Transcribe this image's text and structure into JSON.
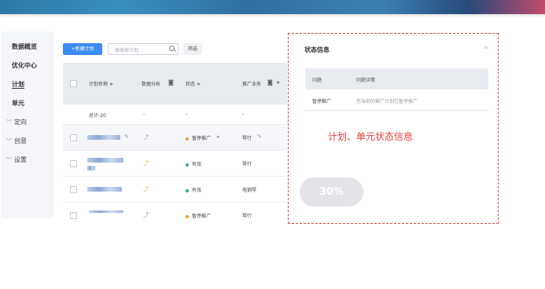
{
  "sidebar": {
    "items": [
      {
        "label": "数据概览"
      },
      {
        "label": "优化中心"
      },
      {
        "label": "计划"
      },
      {
        "label": "单元"
      },
      {
        "label": "定向"
      },
      {
        "label": "创意"
      },
      {
        "label": "设置"
      }
    ]
  },
  "toolbar": {
    "new_plan_label": "+新建计划",
    "search_placeholder": "搜搜索计划",
    "filter_label": "筛选"
  },
  "table": {
    "columns": [
      "计划名称 ≑",
      "数据分析",
      "状态 ≑",
      "推广业务",
      "≑"
    ],
    "total_row": {
      "name": "总计-20",
      "analysis": "-",
      "status": "-",
      "business": "-"
    },
    "rows": [
      {
        "status": "暂停推广",
        "status_color": "#f39b22",
        "business": "琴行"
      },
      {
        "status": "有效",
        "status_color": "#2db36b",
        "business": "琴行"
      },
      {
        "status": "有效",
        "status_color": "#2db36b",
        "business": "电钢琴"
      },
      {
        "status": "暂停推广",
        "status_color": "#f39b22",
        "business": "琴行"
      }
    ]
  },
  "state_panel": {
    "title": "状态信息",
    "close_icon": "×",
    "columns": [
      "问题",
      "问题详情"
    ],
    "rows": [
      {
        "issue": "暂停推广",
        "detail": "您当前的推广计划已暂停推广"
      }
    ],
    "annotation": "计划、单元状态信息"
  },
  "progress": {
    "label": "30%",
    "value": 0.3
  },
  "colors": {
    "accent": "#3b8cf5",
    "annotation": "#e03b3b",
    "paused": "#f39b22",
    "active": "#2db36b"
  }
}
